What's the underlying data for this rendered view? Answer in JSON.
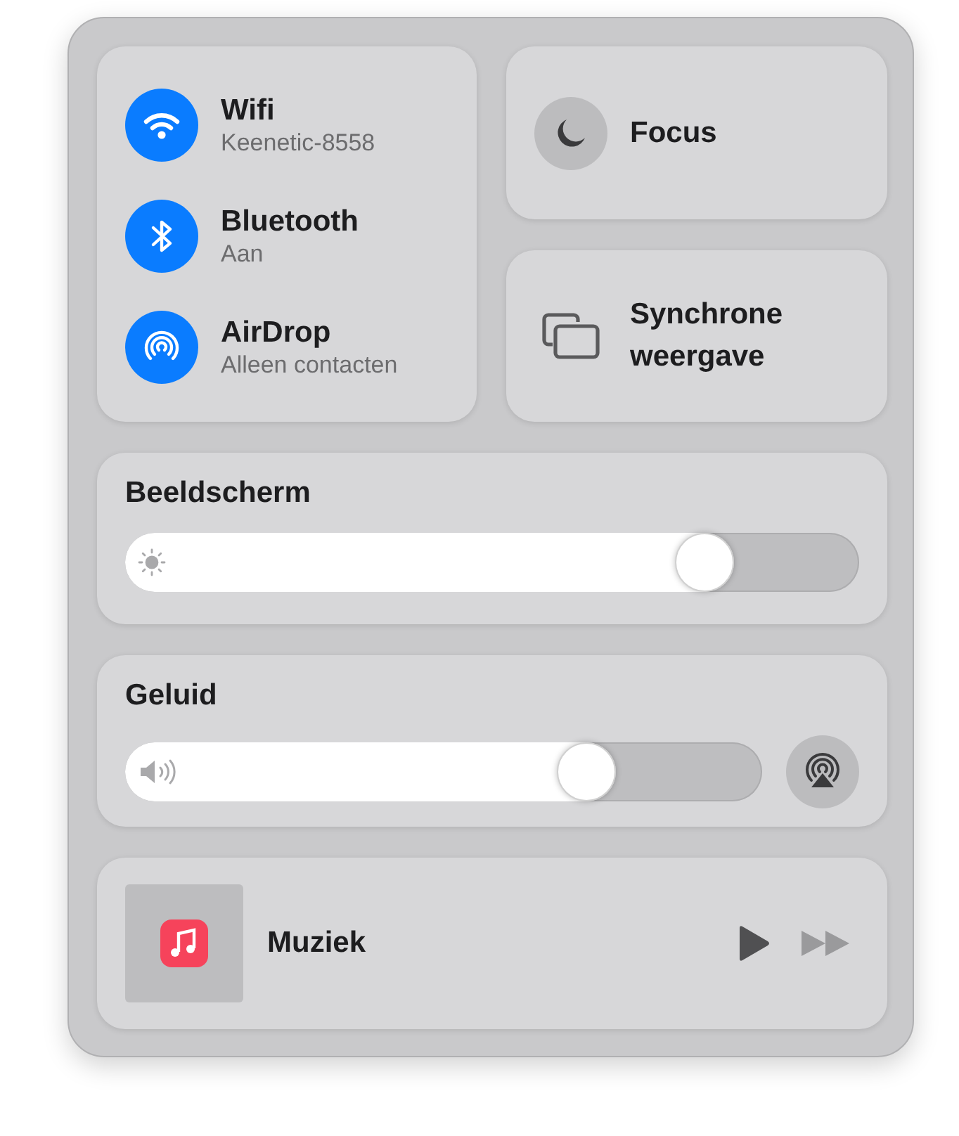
{
  "network": [
    {
      "kind": "wifi",
      "title": "Wifi",
      "subtitle": "Keenetic-8558",
      "on": true
    },
    {
      "kind": "bluetooth",
      "title": "Bluetooth",
      "subtitle": "Aan",
      "on": true
    },
    {
      "kind": "airdrop",
      "title": "AirDrop",
      "subtitle": "Alleen contacten",
      "on": true
    }
  ],
  "focus": {
    "label": "Focus",
    "on": false
  },
  "screen_mirroring": {
    "label": "Synchrone weergave"
  },
  "display": {
    "title": "Beeldscherm",
    "level": 0.83
  },
  "sound": {
    "title": "Geluid",
    "level": 0.77
  },
  "now_playing": {
    "title": "Muziek",
    "controls": [
      {
        "kind": "play",
        "disabled": false
      },
      {
        "kind": "next",
        "disabled": true
      }
    ]
  }
}
